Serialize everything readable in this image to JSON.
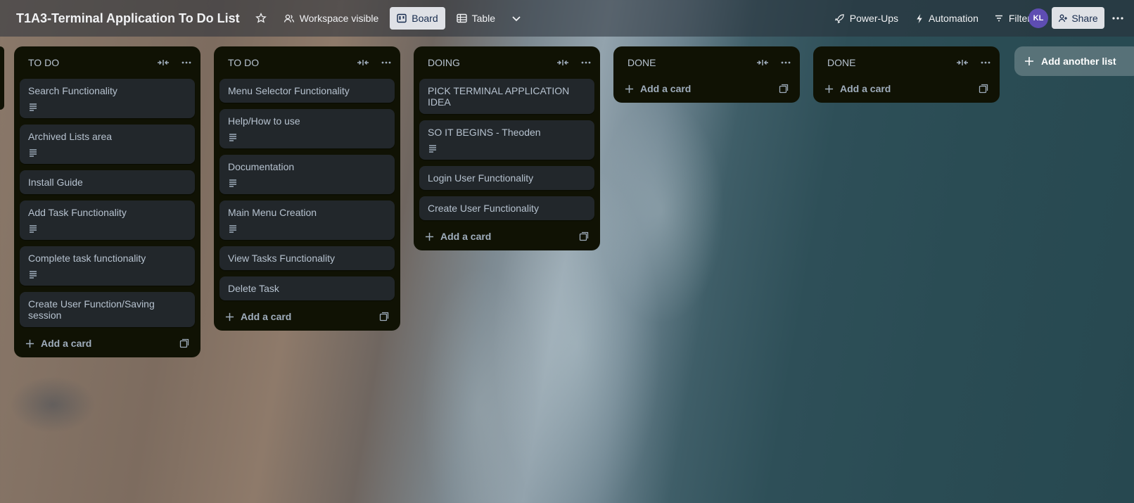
{
  "header": {
    "board_title": "T1A3-Terminal Application To Do List",
    "visibility": "Workspace visible",
    "views": [
      "Board",
      "Table"
    ],
    "power_ups": "Power-Ups",
    "automation": "Automation",
    "filters": "Filters",
    "avatar_initials": "KL",
    "share": "Share"
  },
  "lists": [
    {
      "title": "TO DO",
      "cards": [
        {
          "title": "Search Functionality",
          "has_description": true
        },
        {
          "title": "Archived Lists area",
          "has_description": true
        },
        {
          "title": "Install Guide",
          "has_description": false
        },
        {
          "title": "Add Task Functionality",
          "has_description": true
        },
        {
          "title": "Complete task functionality",
          "has_description": true
        },
        {
          "title": "Create User Function/Saving session",
          "has_description": false
        }
      ],
      "add_card": "Add a card"
    },
    {
      "title": "TO DO",
      "cards": [
        {
          "title": "Menu Selector Functionality",
          "has_description": false
        },
        {
          "title": "Help/How to use",
          "has_description": true
        },
        {
          "title": "Documentation",
          "has_description": true
        },
        {
          "title": "Main Menu Creation",
          "has_description": true
        },
        {
          "title": "View Tasks Functionality",
          "has_description": false
        },
        {
          "title": "Delete Task",
          "has_description": false
        }
      ],
      "add_card": "Add a card"
    },
    {
      "title": "DOING",
      "cards": [
        {
          "title": "PICK TERMINAL APPLICATION IDEA",
          "has_description": false
        },
        {
          "title": "SO IT BEGINS - Theoden",
          "has_description": true
        },
        {
          "title": "Login User Functionality",
          "has_description": false
        },
        {
          "title": "Create User Functionality",
          "has_description": false
        }
      ],
      "add_card": "Add a card"
    },
    {
      "title": "DONE",
      "cards": [],
      "add_card": "Add a card"
    },
    {
      "title": "DONE",
      "cards": [],
      "add_card": "Add a card"
    }
  ],
  "add_list": "Add another list"
}
